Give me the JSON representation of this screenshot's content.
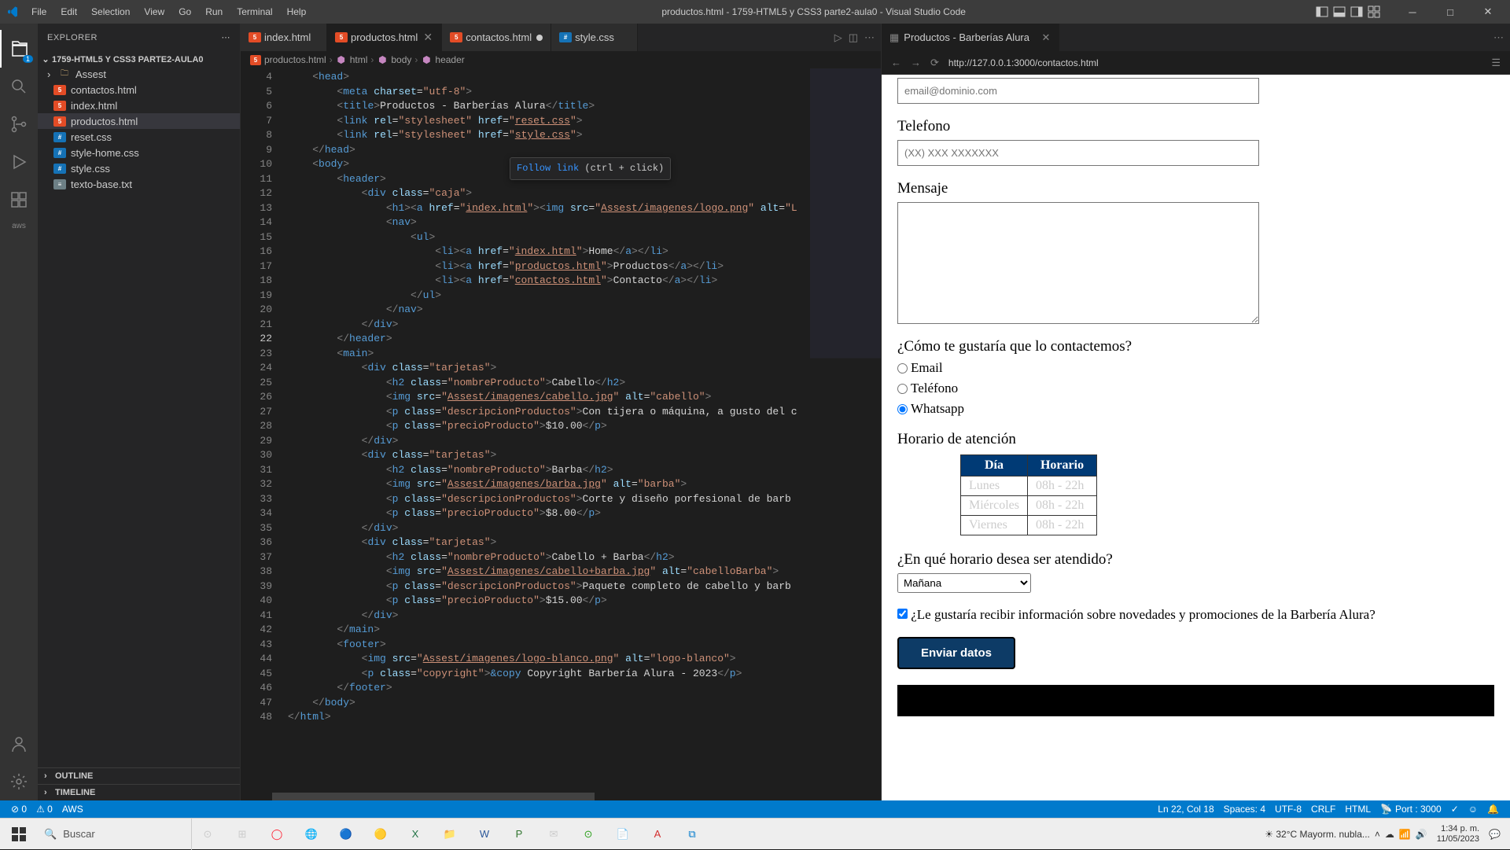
{
  "titlebar": {
    "menus": [
      "File",
      "Edit",
      "Selection",
      "View",
      "Go",
      "Run",
      "Terminal",
      "Help"
    ],
    "title": "productos.html - 1759-HTML5 y CSS3 parte2-aula0 - Visual Studio Code"
  },
  "sidebar": {
    "header": "EXPLORER",
    "root": "1759-HTML5 Y CSS3 PARTE2-AULA0",
    "folder": "Assest",
    "files": [
      {
        "name": "contactos.html",
        "type": "html"
      },
      {
        "name": "index.html",
        "type": "html"
      },
      {
        "name": "productos.html",
        "type": "html",
        "selected": true
      },
      {
        "name": "reset.css",
        "type": "css"
      },
      {
        "name": "style-home.css",
        "type": "css"
      },
      {
        "name": "style.css",
        "type": "css"
      },
      {
        "name": "texto-base.txt",
        "type": "txt"
      }
    ],
    "outline": "OUTLINE",
    "timeline": "TIMELINE"
  },
  "tabs": {
    "left": [
      {
        "name": "index.html",
        "type": "html"
      },
      {
        "name": "productos.html",
        "type": "html",
        "active": true,
        "close": true
      },
      {
        "name": "contactos.html",
        "type": "html",
        "dirty": true
      },
      {
        "name": "style.css",
        "type": "css"
      }
    ]
  },
  "breadcrumbs": {
    "file": "productos.html",
    "el1": "html",
    "el2": "body",
    "el3": "header"
  },
  "tooltip": {
    "link": "Follow link",
    "hint": "(ctrl + click)"
  },
  "browser": {
    "tab": "Productos - Barberías Alura",
    "url": "http://127.0.0.1:3000/contactos.html",
    "email_placeholder": "email@dominio.com",
    "tel_label": "Telefono",
    "tel_placeholder": "(XX) XXX XXXXXXX",
    "msg_label": "Mensaje",
    "contact_q": "¿Cómo te gustaría que lo contactemos?",
    "opt_email": "Email",
    "opt_tel": "Teléfono",
    "opt_wa": "Whatsapp",
    "schedule_label": "Horario de atención",
    "th_day": "Día",
    "th_hours": "Horario",
    "rows": [
      {
        "day": "Lunes",
        "hours": "08h - 22h"
      },
      {
        "day": "Miércoles",
        "hours": "08h - 22h"
      },
      {
        "day": "Viernes",
        "hours": "08h - 22h"
      }
    ],
    "time_q": "¿En qué horario desea ser atendido?",
    "select_val": "Mañana",
    "newsletter": "¿Le gustaría recibir información sobre novedades y promociones de la Barbería Alura?",
    "submit": "Enviar datos"
  },
  "status": {
    "left1": "⊘ 0",
    "left2": "⚠ 0",
    "left3": "AWS",
    "pos": "Ln 22, Col 18",
    "spaces": "Spaces: 4",
    "enc": "UTF-8",
    "eol": "CRLF",
    "lang": "HTML",
    "port": "Port : 3000",
    "check": "✓"
  },
  "taskbar": {
    "search": "Buscar",
    "weather": "32°C  Mayorm. nubla...",
    "time": "1:34 p. m.",
    "date": "11/05/2023"
  },
  "code": {
    "lines": [
      4,
      5,
      6,
      7,
      8,
      9,
      10,
      11,
      12,
      13,
      14,
      15,
      16,
      17,
      18,
      19,
      20,
      21,
      22,
      23,
      24,
      25,
      26,
      27,
      28,
      29,
      30,
      31,
      32,
      33,
      34,
      35,
      36,
      37,
      38,
      39,
      40,
      41,
      42,
      43,
      44,
      45,
      46,
      47,
      48
    ],
    "active_line": 22
  }
}
